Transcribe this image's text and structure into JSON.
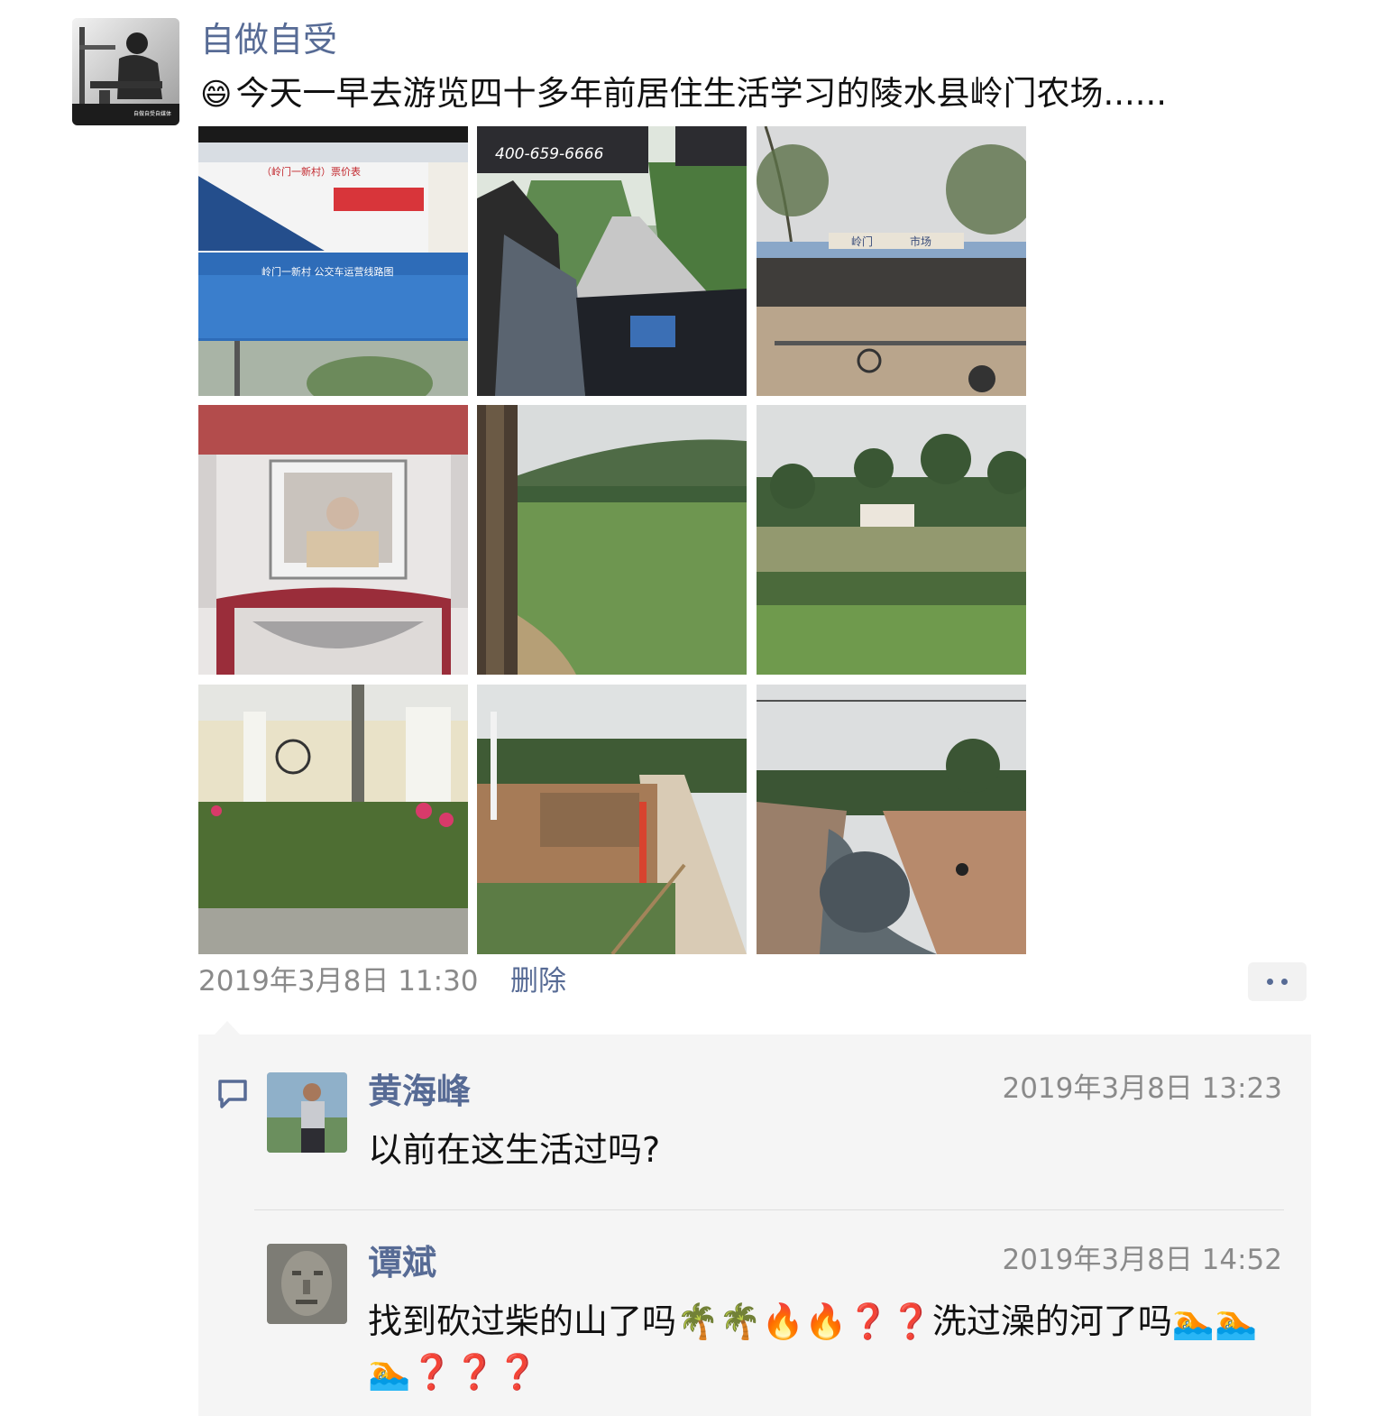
{
  "post": {
    "author": "自做自受",
    "emoji": "😄",
    "text": "今天一早去游览四十多年前居住生活学习的陵水县岭门农场......",
    "avatar_caption": "自做自受自媒体",
    "photos": [
      {
        "name": "photo-bus-fare-sign",
        "texts": [
          "（岭门一新村）票价表",
          "岭门一新村 公交车运营线路图"
        ]
      },
      {
        "name": "photo-bus-driver-road",
        "texts": [
          "400-659-6666"
        ]
      },
      {
        "name": "photo-market-building",
        "texts": [
          "岭门",
          "市场"
        ]
      },
      {
        "name": "photo-vehicle-cabin",
        "texts": []
      },
      {
        "name": "photo-green-field-hills",
        "texts": []
      },
      {
        "name": "photo-palm-trees-field",
        "texts": []
      },
      {
        "name": "photo-mural-wall-flowers",
        "texts": []
      },
      {
        "name": "photo-construction-road",
        "texts": []
      },
      {
        "name": "photo-river-rocks",
        "texts": []
      }
    ],
    "timestamp": "2019年3月8日 11:30",
    "delete_label": "删除",
    "more_icon": "more-dots-icon"
  },
  "comments": {
    "icon": "comment-bubble-icon",
    "items": [
      {
        "name": "黄海峰",
        "time": "2019年3月8日 13:23",
        "text": "以前在这生活过吗?"
      },
      {
        "name": "谭斌",
        "time": "2019年3月8日 14:52",
        "text": "找到砍过柴的山了吗🌴🌴🔥🔥❓❓洗过澡的河了吗🏊🏊🏊❓❓❓"
      }
    ]
  },
  "colors": {
    "link": "#576b95",
    "meta": "#8a8a8a",
    "comment_bg": "#f5f5f5"
  }
}
